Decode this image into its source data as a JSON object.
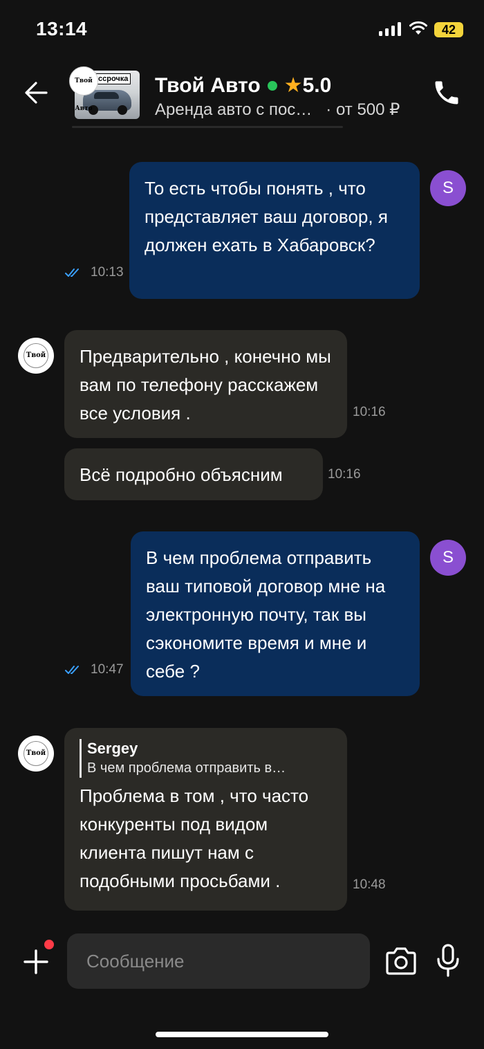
{
  "status_bar": {
    "time": "13:14",
    "battery": "42"
  },
  "header": {
    "title": "Твой Авто",
    "rating": "5.0",
    "subtitle": "Аренда авто с пос…",
    "price": "· от 500 ₽",
    "thumb_tag": "ссрочка",
    "logo_text": "Твой Авто"
  },
  "messages": [
    {
      "id": "m1",
      "direction": "out",
      "text": "То есть чтобы понять , что представляет ваш договор, я должен ехать в Хабаровск?",
      "time": "10:13",
      "avatar": "S"
    },
    {
      "id": "m2",
      "direction": "in",
      "text": "Предварительно , конечно мы вам по телефону расскажем все условия .",
      "time": "10:16",
      "avatar": "Твой Авто"
    },
    {
      "id": "m3",
      "direction": "in",
      "text": "Всё подробно объясним",
      "time": "10:16"
    },
    {
      "id": "m4",
      "direction": "out",
      "text": "В чем проблема отправить ваш типовой договор мне на электронную почту, так вы сэкономите время и мне и себе ?",
      "time": "10:47",
      "avatar": "S"
    },
    {
      "id": "m5",
      "direction": "in",
      "quote_name": "Sergey",
      "quote_text": "В чем проблема отправить в…",
      "text": "Проблема в том , что часто конкуренты под видом клиента пишут нам с подобными просьбами .",
      "time": "10:48",
      "avatar": "Твой Авто"
    }
  ],
  "composer": {
    "placeholder": "Сообщение"
  },
  "colors": {
    "outgoing": "#0a2d5a",
    "incoming": "#2b2a26",
    "online": "#29c45a",
    "star": "#ffb01f",
    "avatar": "#8a4fd1",
    "badge": "#ff3b47"
  }
}
